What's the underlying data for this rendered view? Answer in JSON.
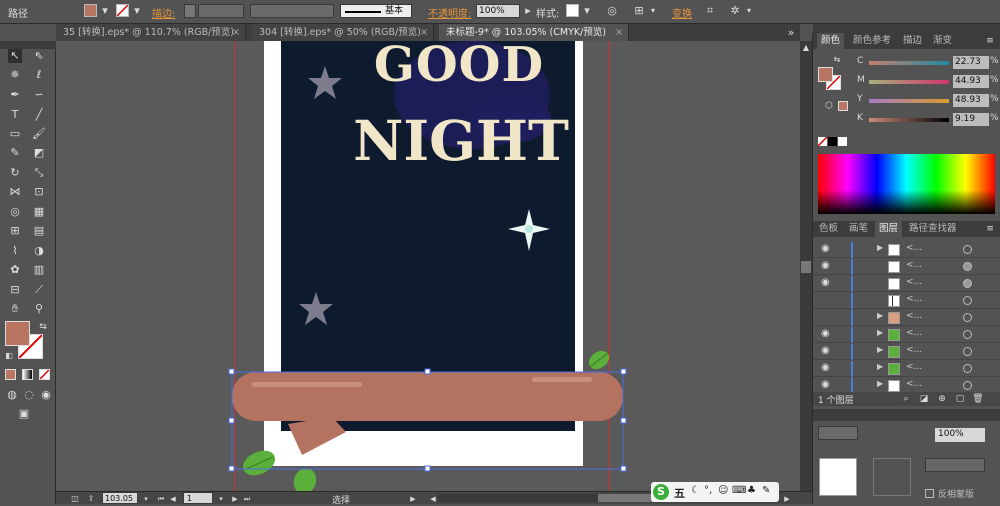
{
  "control_bar": {
    "object_type": "路径",
    "stroke_label": "描边:",
    "stroke_style": "基本",
    "opacity_label": "不透明度:",
    "opacity_value": "100%",
    "style_label": "样式:",
    "transform_label": "变换"
  },
  "doc_tabs": [
    {
      "label": "35 [转换].eps* @ 110.7% (RGB/预览)",
      "close": "×"
    },
    {
      "label": "304 [转换].eps* @ 50% (RGB/预览)",
      "close": "×"
    },
    {
      "label": "未标题-9* @ 103.05% (CMYK/预览)",
      "close": "×"
    }
  ],
  "artwork": {
    "title_line1": "GOOD",
    "title_line2": "NIGHT"
  },
  "status_bar": {
    "zoom": "103.05",
    "page": "1",
    "tool_name": "选择"
  },
  "color_panel": {
    "tabs": [
      "颜色",
      "颜色参考",
      "描边",
      "渐变"
    ],
    "channels": [
      {
        "label": "C",
        "value": "22.73",
        "unit": "%"
      },
      {
        "label": "M",
        "value": "44.93",
        "unit": "%"
      },
      {
        "label": "Y",
        "value": "48.93",
        "unit": "%"
      },
      {
        "label": "K",
        "value": "9.19",
        "unit": "%"
      }
    ]
  },
  "layers_panel": {
    "tabs": [
      "色板",
      "画笔",
      "图层",
      "路径查找器"
    ],
    "row_name": "<...",
    "footer": "1 个图层"
  },
  "lower_panel": {
    "opacity_value": "100%",
    "invert_label": "反相蒙版"
  },
  "ime_bar": {
    "label": "五"
  },
  "colors": {
    "fill": "#b87562",
    "poster_bg": "#0e1b2e",
    "title": "#f1e6c8",
    "branch": "#b47361",
    "leaf": "#5ab03a",
    "star": "#7c7c8c",
    "moon": "#1e1e5c"
  }
}
